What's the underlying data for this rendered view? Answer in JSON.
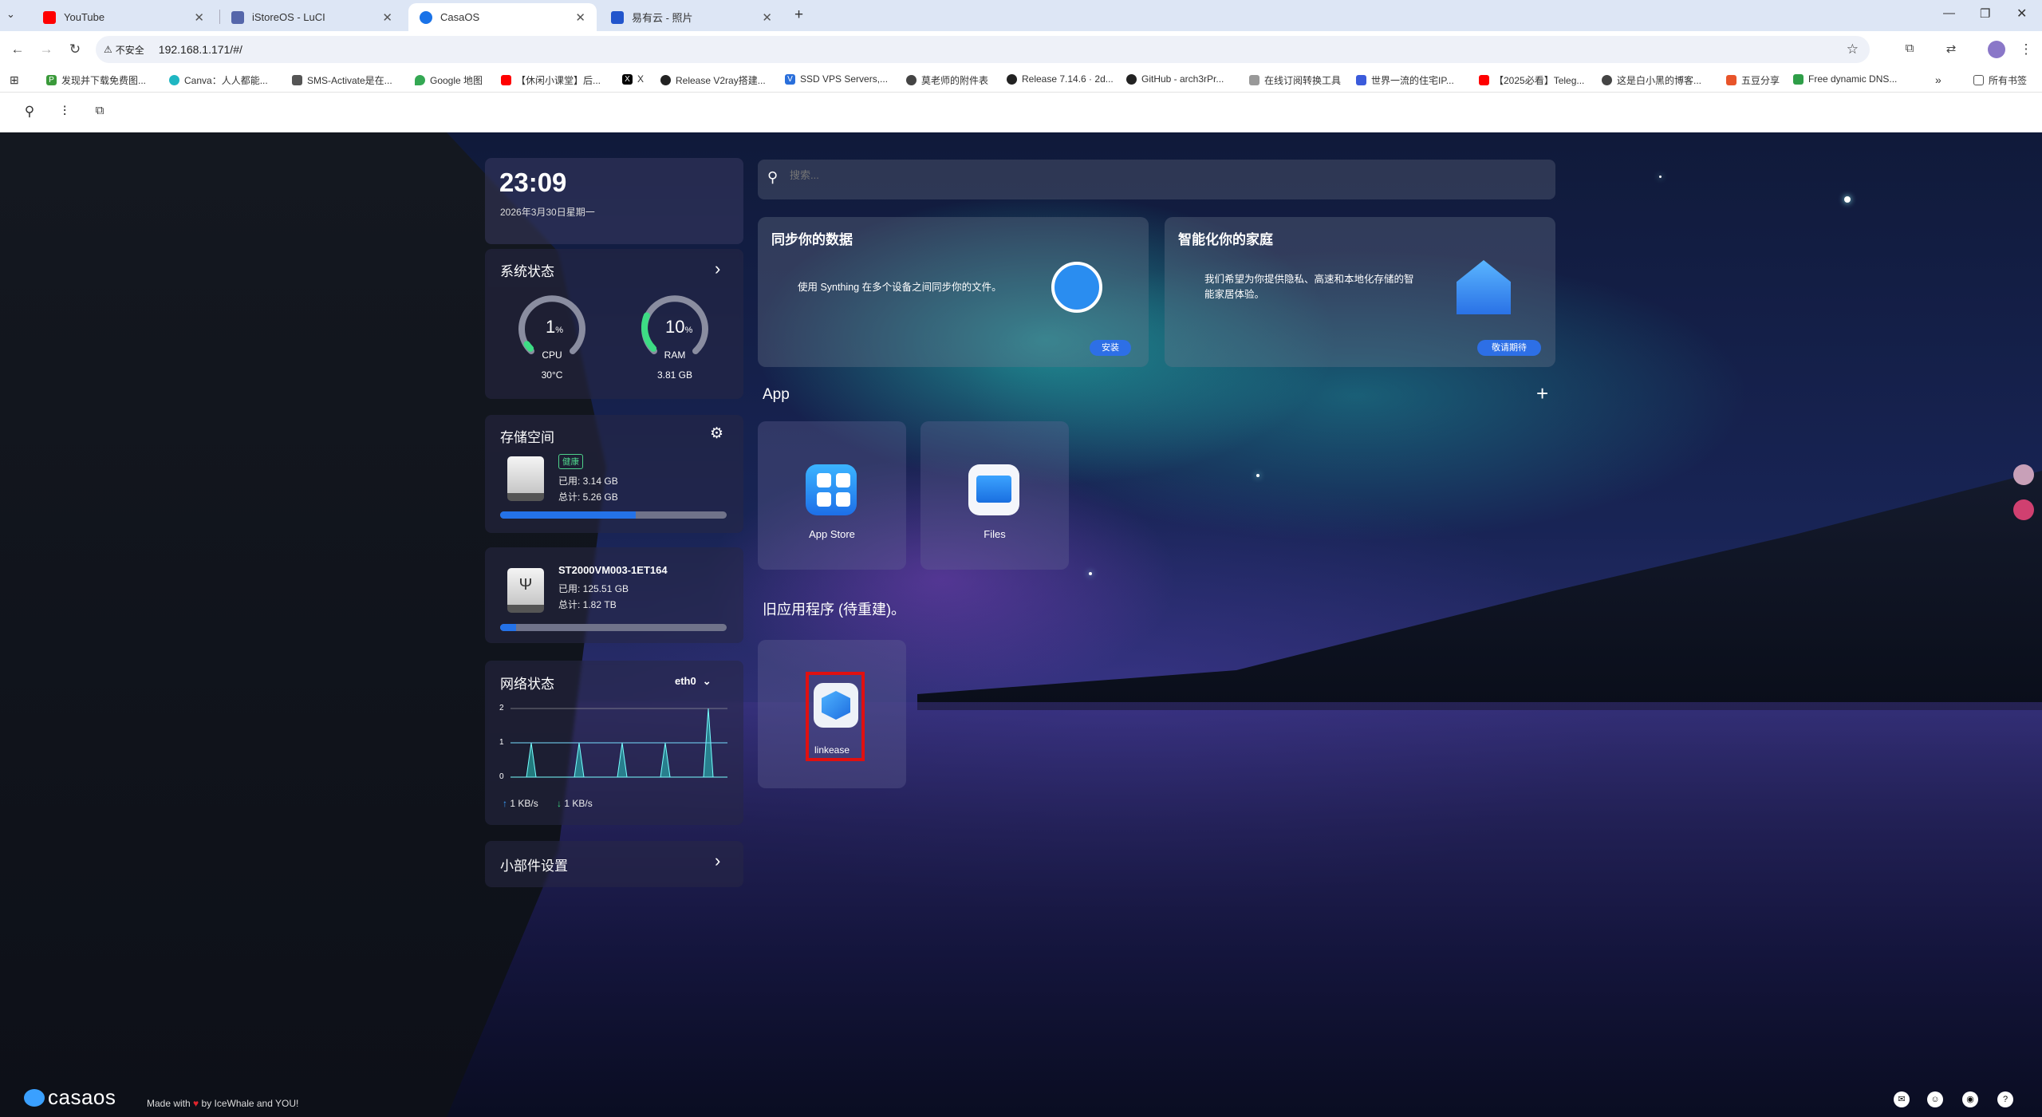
{
  "browser": {
    "tabs": [
      {
        "title": "YouTube",
        "color": "#ff0000"
      },
      {
        "title": "iStoreOS - LuCI",
        "color": "#5566aa"
      },
      {
        "title": "CasaOS",
        "color": "#1a73e8"
      },
      {
        "title": "易有云 - 照片",
        "color": "#2255cc"
      }
    ],
    "security_label": "不安全",
    "url": "192.168.1.171/#/",
    "bookmarks": [
      "发现并下载免费图...",
      "Canva：人人都能...",
      "SMS-Activate是在...",
      "Google 地图",
      "【休闲小课堂】后...",
      "X",
      "Release V2ray搭建...",
      "SSD VPS Servers,...",
      "莫老师的附件表",
      "Release 7.14.6 · 2d...",
      "GitHub - arch3rPr...",
      "在线订阅转换工具",
      "世界一流的住宅IP...",
      "【2025必看】Teleg...",
      "这是白小黑的博客...",
      "五豆分享",
      "Free dynamic DNS..."
    ],
    "bookmarks_folder": "所有书签"
  },
  "clock": {
    "time": "23:09",
    "date": "2026年3月30日星期一"
  },
  "system": {
    "title": "系统状态",
    "cpu": {
      "percent": 1,
      "value": "1",
      "unit": "%",
      "label": "CPU",
      "temp": "30°C"
    },
    "ram": {
      "percent": 10,
      "value": "10",
      "unit": "%",
      "label": "RAM",
      "size": "3.81 GB"
    }
  },
  "storage": {
    "title": "存储空间",
    "disk1": {
      "badge": "健康",
      "used": "已用: 3.14 GB",
      "total": "总计: 5.26 GB",
      "fraction": 0.6
    },
    "disk2": {
      "name": "ST2000VM003-1ET164",
      "used": "已用: 125.51 GB",
      "total": "总计: 1.82 TB",
      "fraction": 0.07
    }
  },
  "network": {
    "title": "网络状态",
    "interface": "eth0",
    "y_ticks": [
      "2",
      "1",
      "0"
    ],
    "upload": "1 KB/s",
    "download": "1 KB/s"
  },
  "widget_settings": "小部件设置",
  "search": {
    "placeholder": "搜索..."
  },
  "sync_card": {
    "title": "同步你的数据",
    "desc": "使用 Synthing 在多个设备之间同步你的文件。",
    "button": "安装"
  },
  "home_card": {
    "title": "智能化你的家庭",
    "desc_line1": "我们希望为你提供隐私、高速和本地化存储的智",
    "desc_line2": "能家居体验。",
    "button": "敬请期待"
  },
  "apps": {
    "title": "App",
    "add": "+",
    "items": [
      "App Store",
      "Files"
    ]
  },
  "legacy": {
    "title": "旧应用程序 (待重建)。",
    "items": [
      "linkease"
    ]
  },
  "footer": {
    "logo": "casaos",
    "made_with": "Made with",
    "by": "by IceWhale and YOU!"
  },
  "colors": {
    "accent": "#2472e8",
    "gauge_track": "#8a8da0",
    "gauge_fill": "#3ddc84",
    "highlight": "#e01010"
  }
}
